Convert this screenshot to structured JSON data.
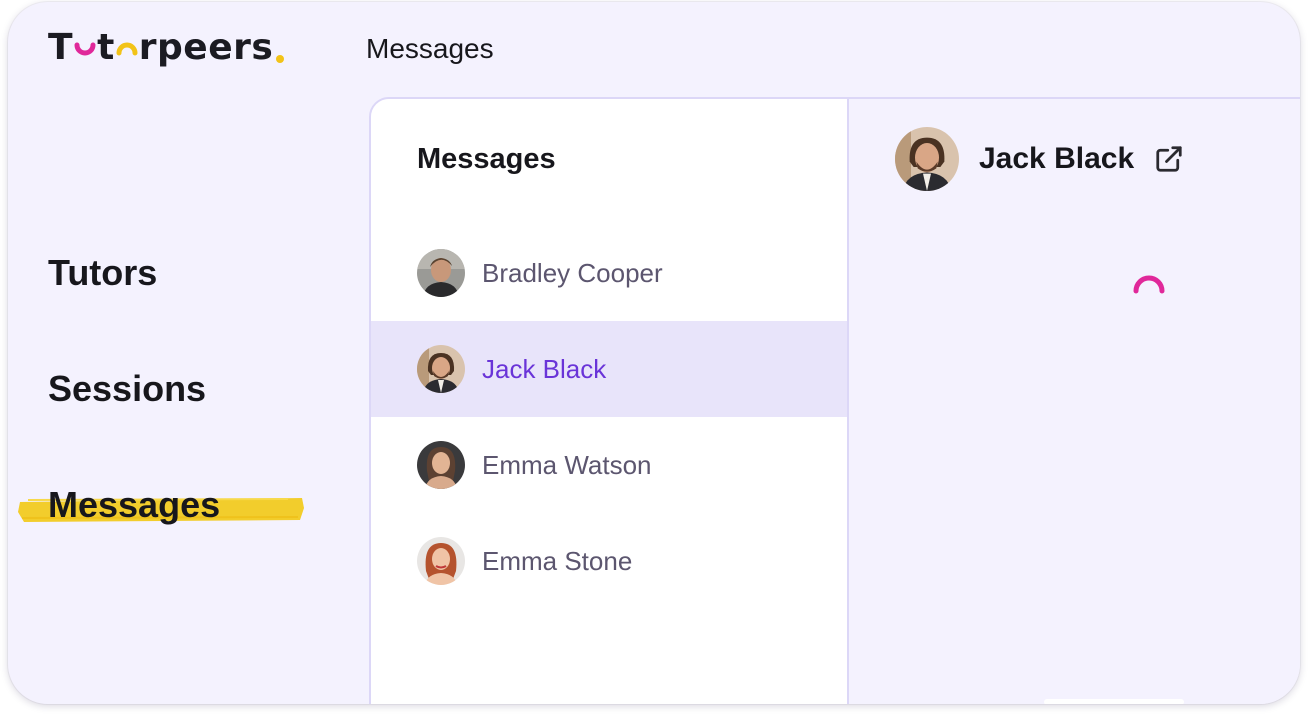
{
  "brand": {
    "logo_text_1": "T",
    "logo_text_2": "t",
    "logo_text_3": "rpeers",
    "accent_pink": "#e0289a",
    "accent_yellow": "#f2c318"
  },
  "header": {
    "title": "Messages"
  },
  "nav": {
    "items": [
      {
        "label": "Tutors"
      },
      {
        "label": "Sessions"
      },
      {
        "label": "Messages",
        "active": true
      }
    ]
  },
  "messages": {
    "title": "Messages",
    "contacts": [
      {
        "name": "Bradley Cooper",
        "avatar": "avatar-bradley-cooper"
      },
      {
        "name": "Jack Black",
        "avatar": "avatar-jack-black",
        "active": true
      },
      {
        "name": "Emma Watson",
        "avatar": "avatar-emma-watson"
      },
      {
        "name": "Emma Stone",
        "avatar": "avatar-emma-stone"
      }
    ]
  },
  "chat": {
    "contact_name": "Jack Black",
    "link_icon": "external-link-icon",
    "status": "loading"
  },
  "colors": {
    "active_text": "#6a34d8",
    "active_bg": "#e8e4fa",
    "app_bg": "#f4f2fe",
    "spinner": "#e0289a"
  }
}
